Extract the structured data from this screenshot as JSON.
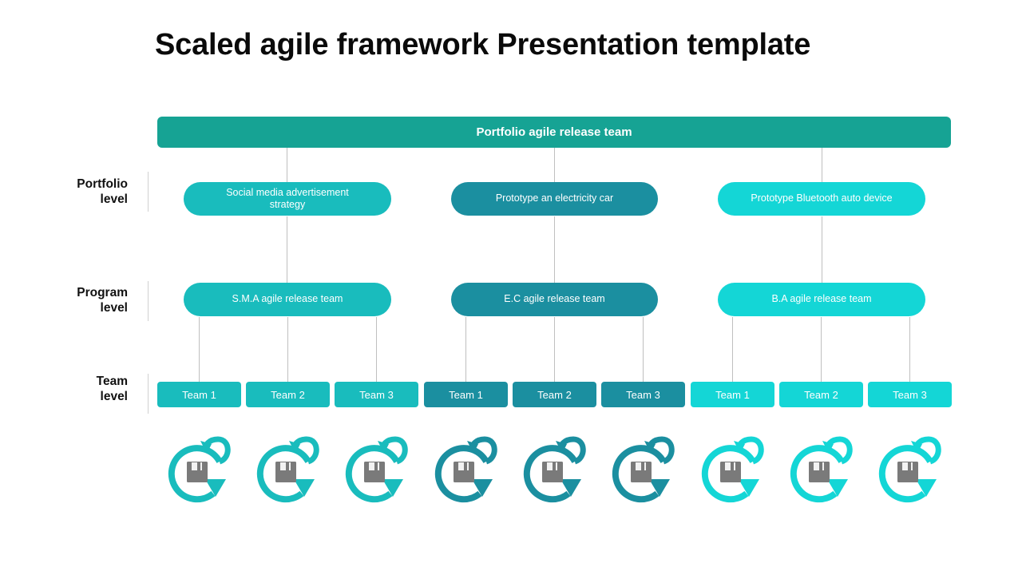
{
  "slide": {
    "title": "Scaled agile framework Presentation template",
    "background": "#ffffff"
  },
  "banner": {
    "label": "Portfolio agile release team",
    "color": "#16a394"
  },
  "levels": [
    {
      "id": "portfolio",
      "line1": "Portfolio",
      "line2": "level"
    },
    {
      "id": "program",
      "line1": "Program",
      "line2": "level"
    },
    {
      "id": "team",
      "line1": "Team",
      "line2": "level"
    }
  ],
  "colors": {
    "group1": "#19bcbd",
    "group2": "#1b8fa0",
    "group3": "#14d6d6",
    "connector": "#bfbfbf",
    "icon_disk": "#7a7a7a",
    "text_on_fill": "#ffffff"
  },
  "columns": [
    {
      "id": "group1",
      "color": "#19bcbd",
      "portfolio": "Social media  advertisement strategy",
      "portfolio_line1": "Social media  advertisement",
      "portfolio_line2": "strategy",
      "program": "S.M.A agile release team",
      "teams": [
        "Team 1",
        "Team 2",
        "Team 3"
      ],
      "icons": [
        "sprint-cycle-icon",
        "sprint-cycle-icon",
        "sprint-cycle-icon"
      ]
    },
    {
      "id": "group2",
      "color": "#1b8fa0",
      "portfolio": "Prototype an electricity car",
      "portfolio_line1": "Prototype an electricity car",
      "portfolio_line2": "",
      "program": "E.C agile release team",
      "teams": [
        "Team 1",
        "Team 2",
        "Team 3"
      ],
      "icons": [
        "sprint-cycle-icon",
        "sprint-cycle-icon",
        "sprint-cycle-icon"
      ]
    },
    {
      "id": "group3",
      "color": "#14d6d6",
      "portfolio": "Prototype Bluetooth auto device",
      "portfolio_line1": "Prototype Bluetooth auto device",
      "portfolio_line2": "",
      "program": "B.A agile release team",
      "teams": [
        "Team 1",
        "Team 2",
        "Team 3"
      ],
      "icons": [
        "sprint-cycle-icon",
        "sprint-cycle-icon",
        "sprint-cycle-icon"
      ]
    }
  ]
}
